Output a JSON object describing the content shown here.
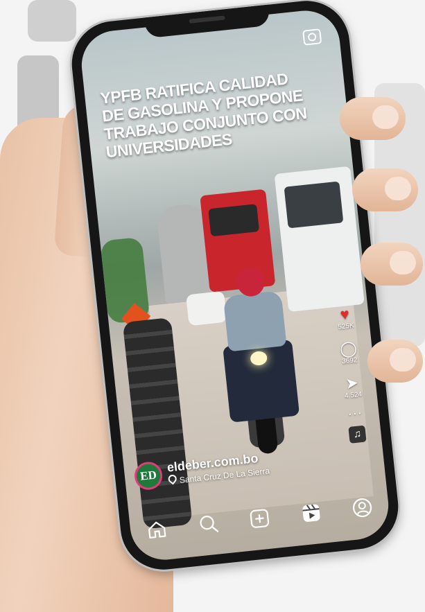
{
  "post": {
    "headline": "YPFB RATIFICA CALIDAD DE GASOLINA Y PROPONE TRABAJO CONJUNTO CON UNIVERSIDADES"
  },
  "account": {
    "avatar_text": "ED",
    "name": "eldeber.com.bo",
    "location": "Santa Cruz De La Sierra"
  },
  "actions": {
    "like_count": "525K",
    "comment_count": "3692",
    "share_count": "4.524"
  },
  "icons": {
    "camera": "camera-icon",
    "like": "heart-icon",
    "comment": "comment-icon",
    "share": "send-icon",
    "more": "more-icon",
    "music": "music-icon",
    "nav": [
      "home-icon",
      "search-icon",
      "add-icon",
      "reels-icon",
      "profile-icon"
    ]
  },
  "colors": {
    "like": "#e02b2b",
    "avatar_bg": "#1e7a3a",
    "avatar_ring": "#e33b7a"
  }
}
